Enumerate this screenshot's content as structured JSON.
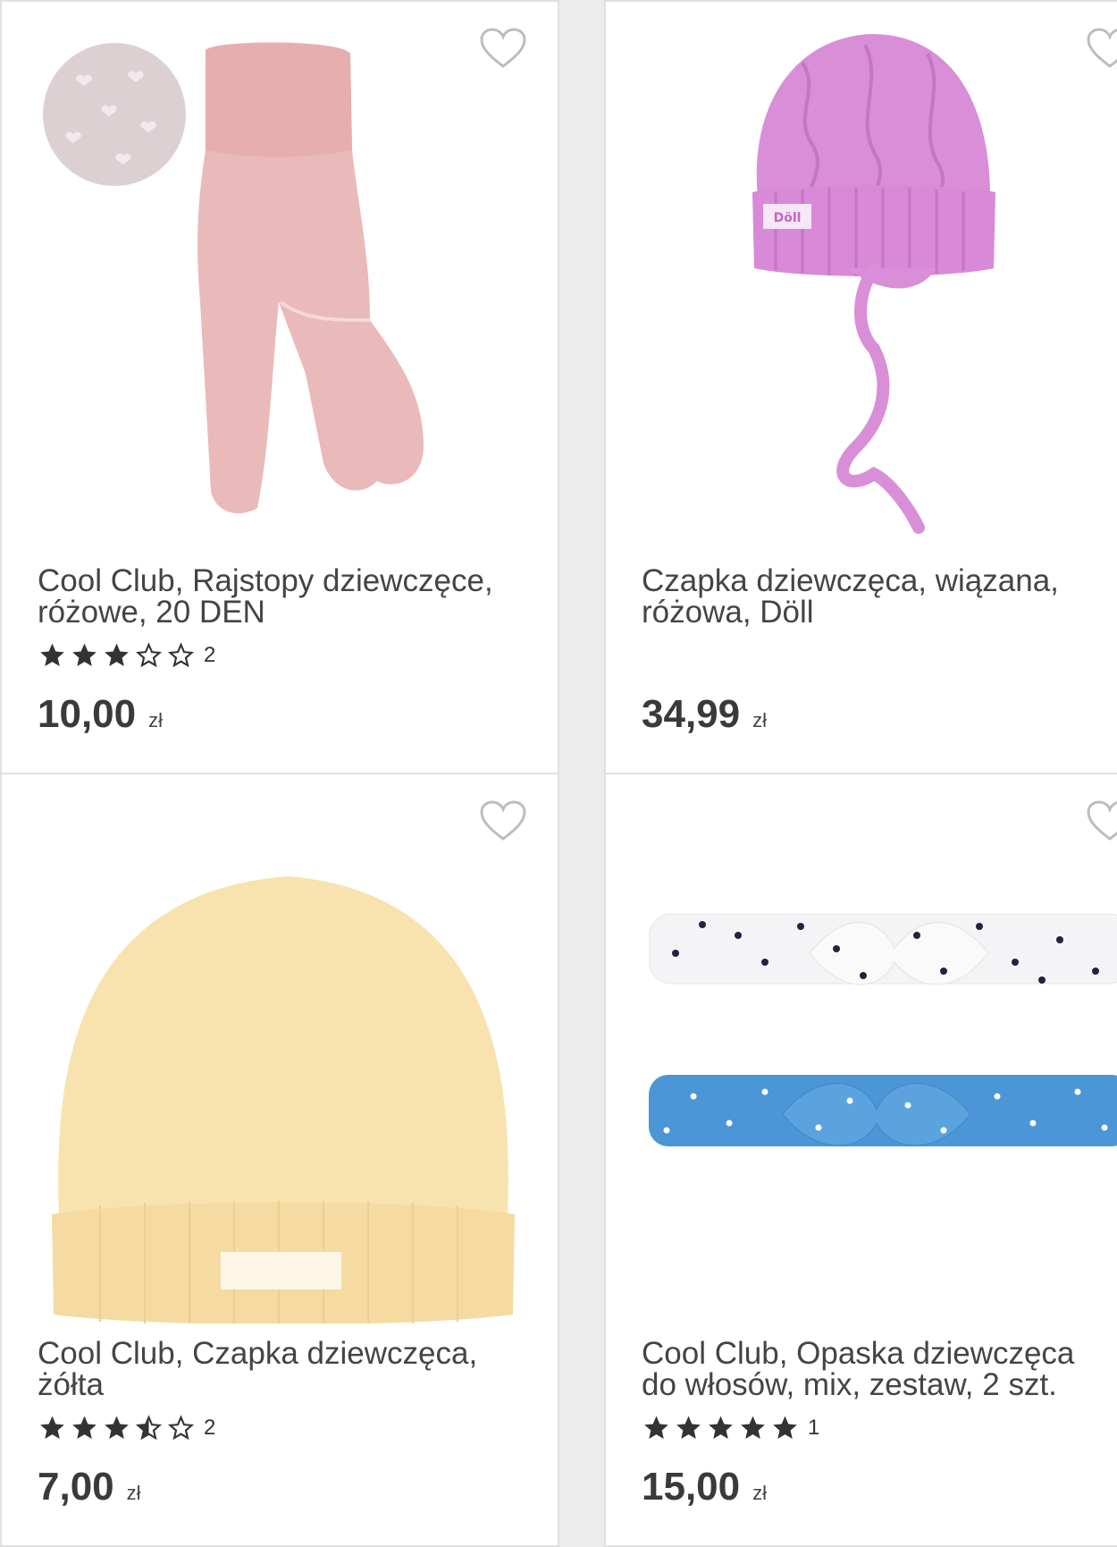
{
  "products": [
    {
      "title": "Cool Club, Rajstopy dziewczęce, różowe, 20 DEN",
      "rating": 3,
      "rating_count": "2",
      "price": "10,00",
      "currency": "zł",
      "image": "pink-tights"
    },
    {
      "title": "Czapka dziewczęca, wiązana, różowa, Döll",
      "rating": null,
      "rating_count": "",
      "price": "34,99",
      "currency": "zł",
      "image": "pink-knit-hat"
    },
    {
      "title": "Cool Club, Czapka dziewczęca, żółta",
      "rating": 3.5,
      "rating_count": "2",
      "price": "7,00",
      "currency": "zł",
      "image": "yellow-beanie"
    },
    {
      "title": "Cool Club, Opaska dziewczęca do włosów, mix, zestaw, 2 szt.",
      "rating": 5,
      "rating_count": "1",
      "price": "15,00",
      "currency": "zł",
      "image": "headbands"
    }
  ],
  "colors": {
    "star": "#333333",
    "heart_outline": "#bdbdbd",
    "price": "#3a3a3a"
  }
}
